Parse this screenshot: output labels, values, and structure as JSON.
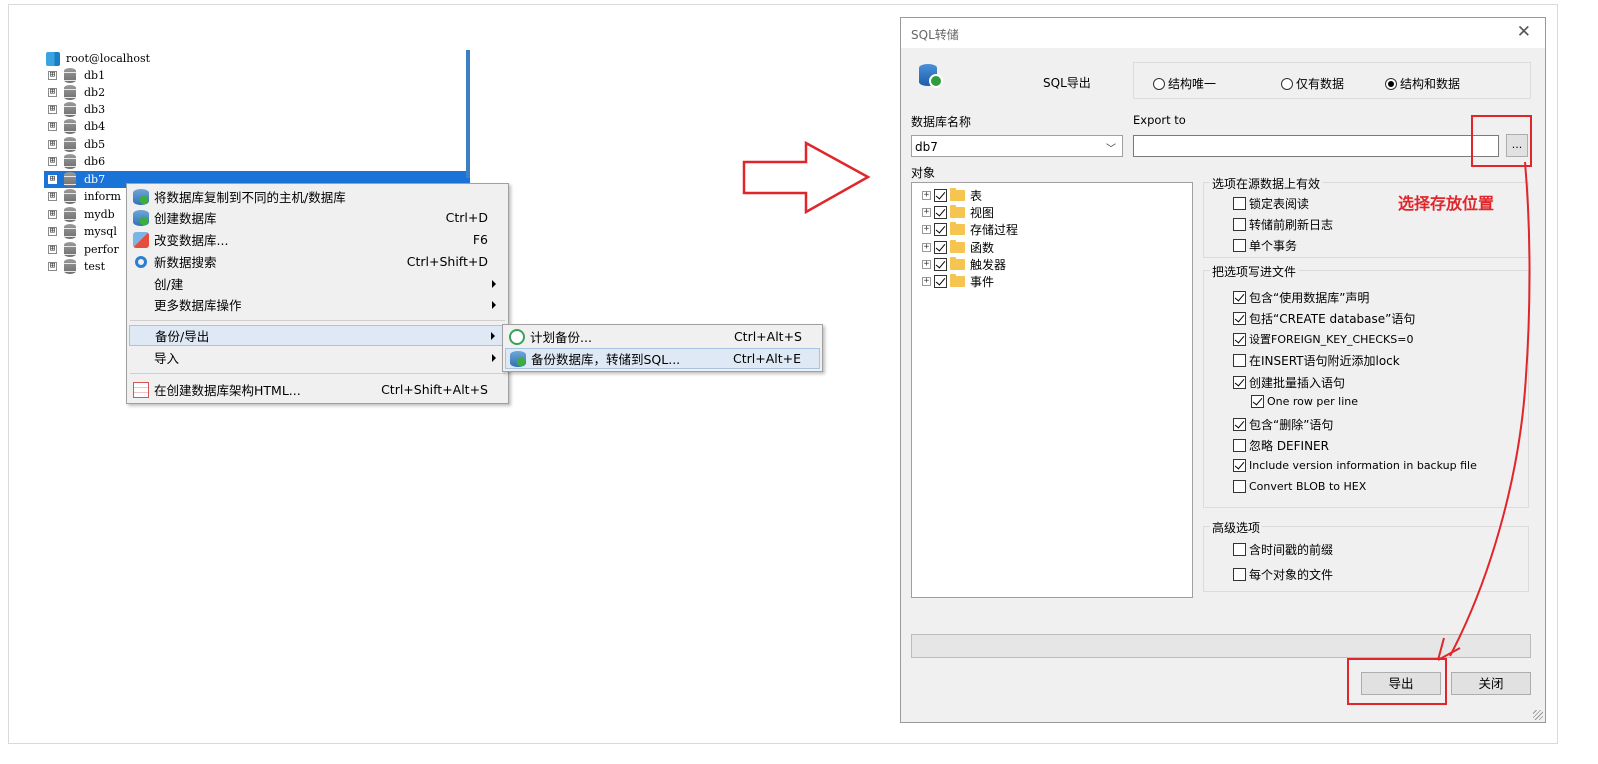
{
  "tree": {
    "root": "root@localhost",
    "items": [
      {
        "label": "db1"
      },
      {
        "label": "db2"
      },
      {
        "label": "db3"
      },
      {
        "label": "db4"
      },
      {
        "label": "db5"
      },
      {
        "label": "db6"
      },
      {
        "label": "db7"
      },
      {
        "label": "inform"
      },
      {
        "label": "mydb"
      },
      {
        "label": "mysql"
      },
      {
        "label": "perfor"
      },
      {
        "label": "test"
      }
    ],
    "selected": "db7",
    "expander": "⊞"
  },
  "context_menu": {
    "items": [
      {
        "label": "将数据库复制到不同的主机/数据库",
        "shortcut": "",
        "icon": "copy-db-icon"
      },
      {
        "label": "创建数据库",
        "shortcut": "Ctrl+D",
        "icon": "create-db-icon"
      },
      {
        "label": "改变数据库...",
        "shortcut": "F6",
        "icon": "alter-db-icon"
      },
      {
        "label": "新数据搜索",
        "shortcut": "Ctrl+Shift+D",
        "icon": "search-icon"
      },
      {
        "label": "创/建",
        "shortcut": ""
      },
      {
        "label": "更多数据库操作",
        "shortcut": ""
      },
      {
        "label": "备份/导出",
        "shortcut": ""
      },
      {
        "label": "导入",
        "shortcut": ""
      },
      {
        "label": "在创建数据库架构HTML...",
        "shortcut": "Ctrl+Shift+Alt+S",
        "icon": "html-icon"
      }
    ]
  },
  "submenu": {
    "items": [
      {
        "label": "计划备份...",
        "shortcut": "Ctrl+Alt+S"
      },
      {
        "label": "备份数据库，转储到SQL...",
        "shortcut": "Ctrl+Alt+E"
      }
    ]
  },
  "dialog": {
    "title": "SQL转储",
    "close": "✕",
    "export_label": "SQL导出",
    "modes": [
      {
        "label": "结构唯一",
        "checked": false
      },
      {
        "label": "仅有数据",
        "checked": false
      },
      {
        "label": "结构和数据",
        "checked": true
      }
    ],
    "db_name_label": "数据库名称",
    "db_name_value": "db7",
    "export_to_label": "Export to",
    "export_to_value": "",
    "browse_label": "...",
    "objects_label": "对象",
    "objects": [
      {
        "label": "表"
      },
      {
        "label": "视图"
      },
      {
        "label": "存储过程"
      },
      {
        "label": "函数"
      },
      {
        "label": "触发器"
      },
      {
        "label": "事件"
      }
    ],
    "source_group": {
      "title": "选项在源数据上有效",
      "options": [
        {
          "label": "锁定表阅读",
          "checked": false
        },
        {
          "label": "转储前刷新日志",
          "checked": false
        },
        {
          "label": "单个事务",
          "checked": false
        }
      ]
    },
    "file_group": {
      "title": "把选项写进文件",
      "options": [
        {
          "label": "包含“使用数据库”声明",
          "checked": true
        },
        {
          "label": "包括“CREATE database”语句",
          "checked": true
        },
        {
          "label": "设置FOREIGN_KEY_CHECKS=0",
          "checked": true
        },
        {
          "label": "在INSERT语句附近添加lock",
          "checked": false
        },
        {
          "label": "创建批量插入语句",
          "checked": true
        },
        {
          "label": "One row per line",
          "checked": true
        },
        {
          "label": "包含“删除”语句",
          "checked": true
        },
        {
          "label": "忽略 DEFINER",
          "checked": false
        },
        {
          "label": "Include version information in backup file",
          "checked": true
        },
        {
          "label": "Convert BLOB to HEX",
          "checked": false
        }
      ]
    },
    "advanced_group": {
      "title": "高级选项",
      "options": [
        {
          "label": "含时间戳的前缀",
          "checked": false
        },
        {
          "label": "每个对象的文件",
          "checked": false
        }
      ]
    },
    "export_button": "导出",
    "close_button": "关闭"
  },
  "annotation": {
    "text": "选择存放位置",
    "color": "#e0262a"
  }
}
